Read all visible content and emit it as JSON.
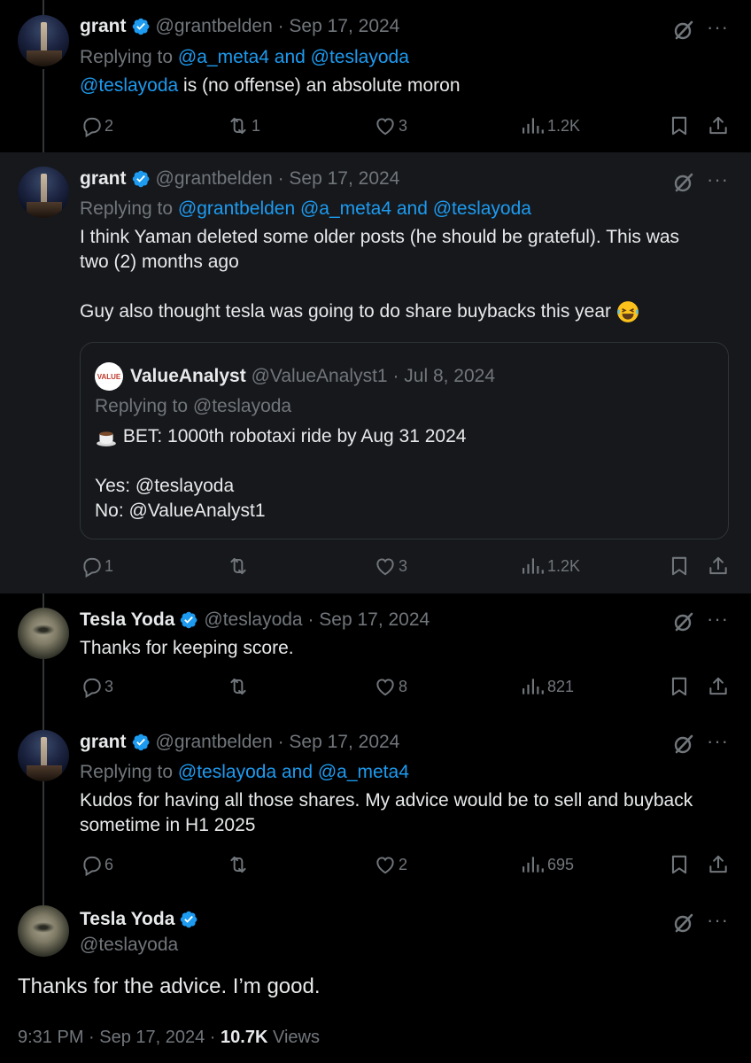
{
  "colors": {
    "background": "#000000",
    "highlight": "#16181c",
    "link": "#1d9bf0",
    "muted": "#71767b",
    "text": "#e7e9ea",
    "verified": "#1d9bf0"
  },
  "tweets": [
    {
      "name": "grant",
      "handle": "@grantbelden",
      "date": "· Sep 17, 2024",
      "reply_prefix": "Replying to",
      "reply_targets": "@a_meta4 and @teslayoda",
      "mention": "@teslayoda",
      "body": " is (no offense) an absolute moron",
      "replies": "2",
      "reposts": "1",
      "likes": "3",
      "views": "1.2K"
    },
    {
      "name": "grant",
      "handle": "@grantbelden",
      "date": "· Sep 17, 2024",
      "reply_prefix": "Replying to",
      "reply_targets": "@grantbelden @a_meta4 and @teslayoda",
      "body_line1": "I think Yaman deleted some older posts (he should be grateful). This was",
      "body_line2": "two (2) months ago",
      "body_line3": "Guy also thought tesla was going to do share buybacks this year",
      "quote": {
        "avatar_text": "VALUE",
        "name": "ValueAnalyst",
        "handle": "@ValueAnalyst1",
        "date": "· Jul 8, 2024",
        "reply_line": "Replying to @teslayoda",
        "line1": "BET: 1000th robotaxi ride by Aug 31 2024",
        "line2": "Yes: @teslayoda",
        "line3": "No: @ValueAnalyst1"
      },
      "replies": "1",
      "reposts": "",
      "likes": "3",
      "views": "1.2K"
    },
    {
      "name": "Tesla Yoda",
      "handle": "@teslayoda",
      "date": "· Sep 17, 2024",
      "body": "Thanks for keeping score.",
      "replies": "3",
      "reposts": "",
      "likes": "8",
      "views": "821"
    },
    {
      "name": "grant",
      "handle": "@grantbelden",
      "date": "· Sep 17, 2024",
      "reply_prefix": "Replying to",
      "reply_targets": "@teslayoda and @a_meta4",
      "body_line1": "Kudos for having all those shares. My advice would be to sell and buyback",
      "body_line2": "sometime in H1 2025",
      "replies": "6",
      "reposts": "",
      "likes": "2",
      "views": "695"
    }
  ],
  "main_post": {
    "name": "Tesla Yoda",
    "handle": "@teslayoda",
    "body": "Thanks for the advice. I’m good.",
    "time": "9:31 PM · Sep 17, 2024 · ",
    "views_count": "10.7K",
    "views_label": " Views"
  },
  "more_symbol": "···",
  "icons": [
    "verified-badge-icon",
    "grok-icon",
    "more-icon",
    "reply-icon",
    "repost-icon",
    "like-icon",
    "views-icon",
    "bookmark-icon",
    "share-icon",
    "coffee-emoji-icon",
    "laughing-emoji-icon"
  ]
}
